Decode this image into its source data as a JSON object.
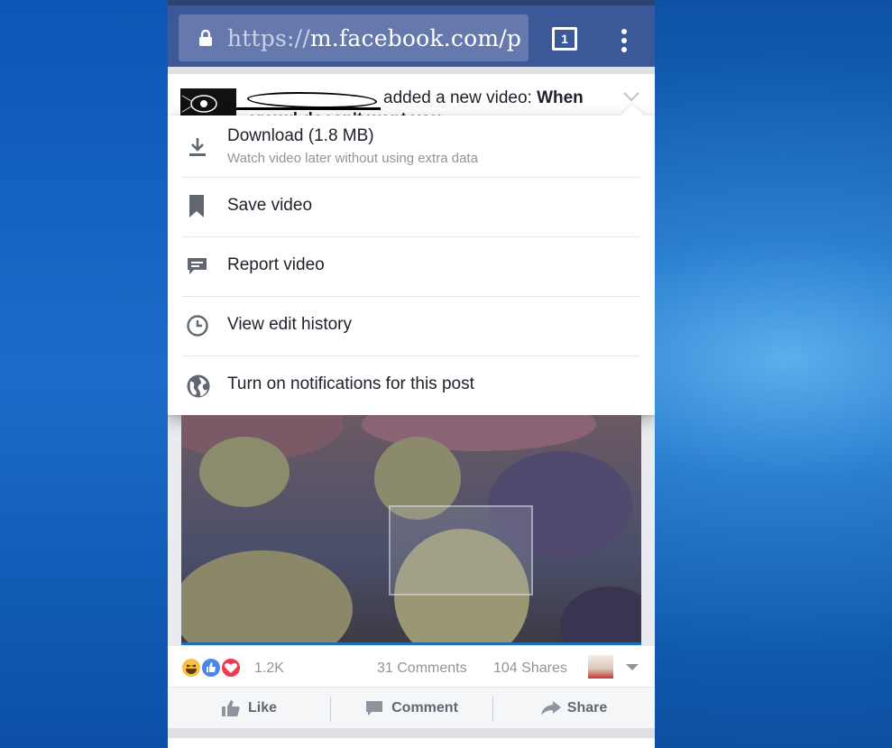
{
  "browser": {
    "url_scheme": "https://",
    "url_host": "m.facebook.com/p",
    "tab_count": "1"
  },
  "post": {
    "action_text": "added a new video:",
    "title_bold": "When",
    "title_line2": "crowd doesn't want you"
  },
  "menu": {
    "items": [
      {
        "label": "Download (1.8 MB)",
        "sub": "Watch video later without using extra data",
        "icon": "download-icon"
      },
      {
        "label": "Save video",
        "icon": "bookmark-icon"
      },
      {
        "label": "Report video",
        "icon": "report-icon"
      },
      {
        "label": "View edit history",
        "icon": "clock-icon"
      },
      {
        "label": "Turn on notifications for this post",
        "icon": "globe-icon"
      }
    ]
  },
  "stats": {
    "reactions_count": "1.2K",
    "comments": "31 Comments",
    "shares": "104 Shares"
  },
  "actions": {
    "like": "Like",
    "comment": "Comment",
    "share": "Share"
  },
  "colors": {
    "facebook_blue": "#3b5998",
    "text": "#1d2129",
    "muted": "#90949c"
  }
}
